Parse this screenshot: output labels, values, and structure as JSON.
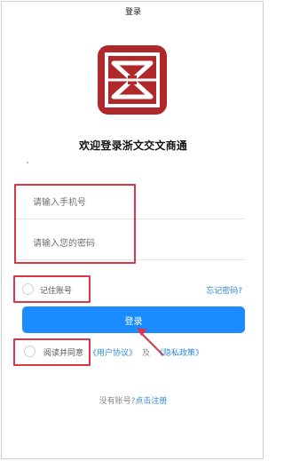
{
  "header": {
    "title": "登录"
  },
  "app": {
    "title": "欢迎登录浙文交文商通",
    "logo_icon": "seal-logo-icon",
    "brand_color": "#B1282A"
  },
  "form": {
    "phone_placeholder": "请输入手机号",
    "password_placeholder": "请输入您的密码",
    "remember_label": "记住账号",
    "forgot_label": "忘记密码?",
    "login_button": "登录"
  },
  "agreement": {
    "prefix": "阅读并同意",
    "user_agreement": "《用户协议》",
    "and": "及",
    "privacy_policy": "《隐私政策》"
  },
  "signup": {
    "prompt": "没有账号?",
    "link": "点击注册"
  },
  "colors": {
    "accent": "#1A8CFF",
    "link": "#2F8AD8",
    "annotation": "#D9364A"
  }
}
